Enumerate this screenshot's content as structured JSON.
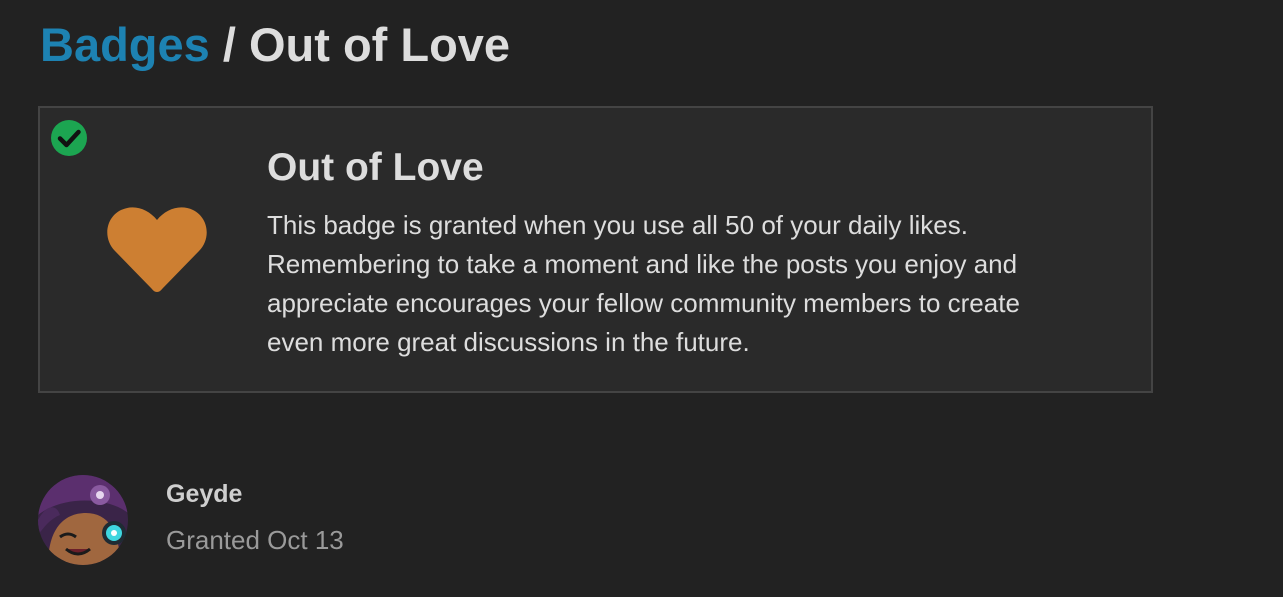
{
  "breadcrumb": {
    "root_label": "Badges",
    "separator": "/",
    "current_label": "Out of Love"
  },
  "badge": {
    "title": "Out of Love",
    "description": "This badge is granted when you use all 50 of your daily likes. Remembering to take a moment and like the posts you enjoy and appreciate encourages your fellow community members to create even more great discussions in the future.",
    "icon": "heart-icon",
    "status_icon": "check-circle-icon"
  },
  "grantee": {
    "username": "Geyde",
    "granted_text": "Granted Oct 13"
  },
  "colors": {
    "background": "#222222",
    "link": "#1d82b2",
    "heart": "#cd7f32",
    "check": "#1ca551"
  }
}
